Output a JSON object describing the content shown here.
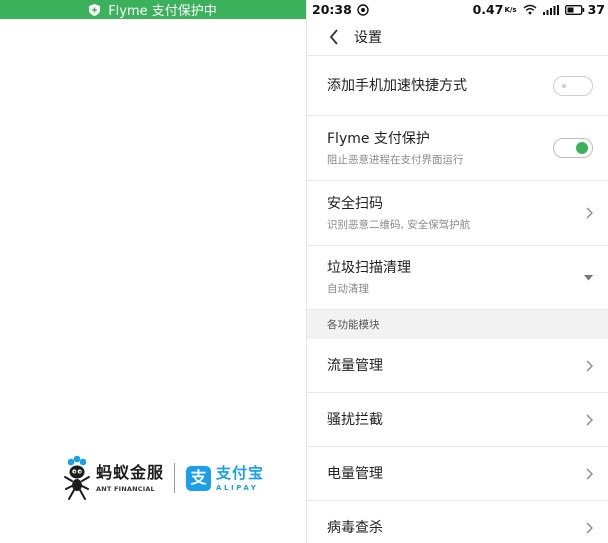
{
  "left": {
    "banner_text": "Flyme 支付保护中",
    "ant_name_cn": "蚂蚁金服",
    "ant_name_en": "ANT FINANCIAL",
    "alipay_name_cn": "支付宝",
    "alipay_name_en": "ALIPAY",
    "alipay_glyph": "支",
    "colors": {
      "banner": "#3bb15b",
      "alipay": "#1aa0e8"
    }
  },
  "status_bar": {
    "time": "20:38",
    "speed": "0.47",
    "speed_unit": "K/s",
    "battery": "37",
    "icons": [
      "notification-icon",
      "wifi-icon",
      "signal-icon",
      "battery-icon"
    ]
  },
  "header": {
    "title": "设置"
  },
  "settings": {
    "accelerate": {
      "label": "添加手机加速快捷方式",
      "toggle": "off"
    },
    "flyme_pay": {
      "label": "Flyme 支付保护",
      "sub": "阻止恶意进程在支付界面运行",
      "toggle": "on"
    },
    "scan": {
      "label": "安全扫码",
      "sub": "识别恶意二维码, 安全保驾护航"
    },
    "junk": {
      "label": "垃圾扫描清理",
      "sub": "自动清理"
    },
    "section_title": "各功能模块",
    "traffic": {
      "label": "流量管理"
    },
    "harass": {
      "label": "骚扰拦截"
    },
    "power": {
      "label": "电量管理"
    },
    "virus": {
      "label": "病毒查杀"
    }
  },
  "accent_color": "#3bb15b"
}
